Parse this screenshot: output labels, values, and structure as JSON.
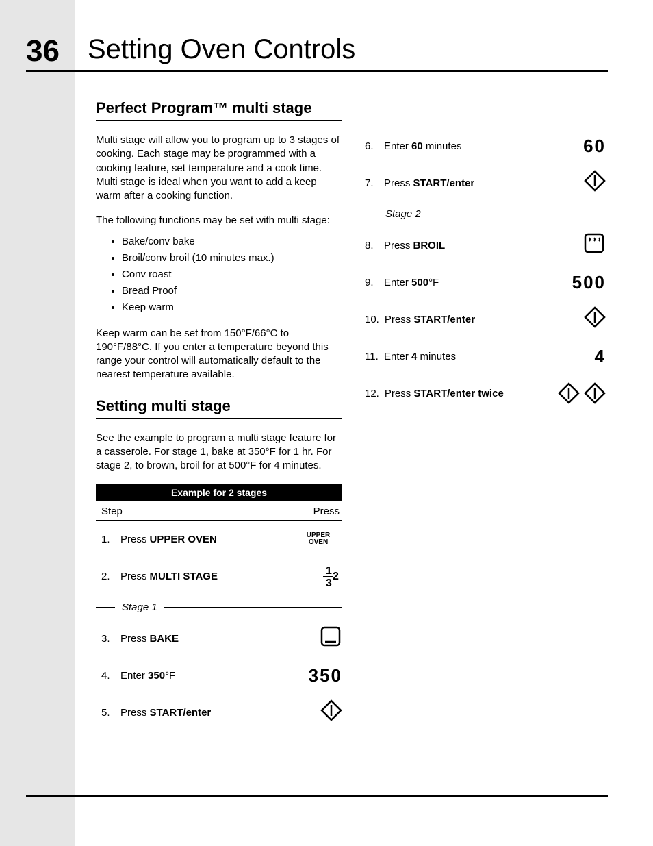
{
  "page_number": "36",
  "title": "Setting Oven Controls",
  "section1": {
    "heading": "Perfect Program™ multi stage",
    "para1": "Multi stage will allow you to program up to 3 stages of cooking. Each stage may be programmed with a cooking feature, set temperature and a cook time. Multi stage is ideal when you want to add a keep warm after a cooking function.",
    "para2": "The following functions may be set with multi stage:",
    "bullets": [
      "Bake/conv bake",
      "Broil/conv broil (10 minutes max.)",
      "Conv roast",
      "Bread Proof",
      "Keep warm"
    ],
    "para3": "Keep warm can be set from 150°F/66°C to 190°F/88°C. If you enter a temperature beyond this range your control will automatically default to the nearest temperature available."
  },
  "section2": {
    "heading": "Setting multi stage",
    "para1": "See the example to program a multi stage feature for a casserole. For stage 1, bake at 350°F for 1 hr. For stage 2, to brown, broil for at 500°F for 4 minutes.",
    "table_title": "Example for 2 stages",
    "col_step": "Step",
    "col_press": "Press"
  },
  "stage1_label": "Stage 1",
  "stage2_label": "Stage 2",
  "steps_left": [
    {
      "n": "1.",
      "pre": "Press ",
      "bold": "UPPER OVEN",
      "post": "",
      "icon": "upper-oven"
    },
    {
      "n": "2.",
      "pre": "Press ",
      "bold": "MULTI STAGE",
      "post": "",
      "icon": "multistage"
    },
    {
      "separator": "Stage 1"
    },
    {
      "n": "3.",
      "pre": "Press ",
      "bold": "BAKE",
      "post": "",
      "icon": "bake"
    },
    {
      "n": "4.",
      "pre": "Enter ",
      "bold": "350",
      "post": "°F",
      "display": "350"
    },
    {
      "n": "5.",
      "pre": "Press ",
      "bold": "START/enter",
      "post": "",
      "icon": "start"
    }
  ],
  "steps_right": [
    {
      "n": "6.",
      "pre": "Enter ",
      "bold": "60",
      "post": " minutes",
      "display": "60"
    },
    {
      "n": "7.",
      "pre": "Press ",
      "bold": "START/enter",
      "post": "",
      "icon": "start"
    },
    {
      "separator": "Stage 2"
    },
    {
      "n": "8.",
      "pre": "Press ",
      "bold": "BROIL",
      "post": "",
      "icon": "broil"
    },
    {
      "n": "9.",
      "pre": "Enter ",
      "bold": "500",
      "post": "°F",
      "display": "500"
    },
    {
      "n": "10.",
      "pre": "Press ",
      "bold": "START/enter",
      "post": "",
      "icon": "start"
    },
    {
      "n": "11.",
      "pre": "Enter ",
      "bold": "4",
      "post": " minutes",
      "display": "4"
    },
    {
      "n": "12.",
      "pre": "Press ",
      "bold": "START/enter twice",
      "post": "",
      "icon": "start-double"
    }
  ],
  "icons": {
    "upper_oven_l1": "UPPER",
    "upper_oven_l2": "OVEN"
  }
}
